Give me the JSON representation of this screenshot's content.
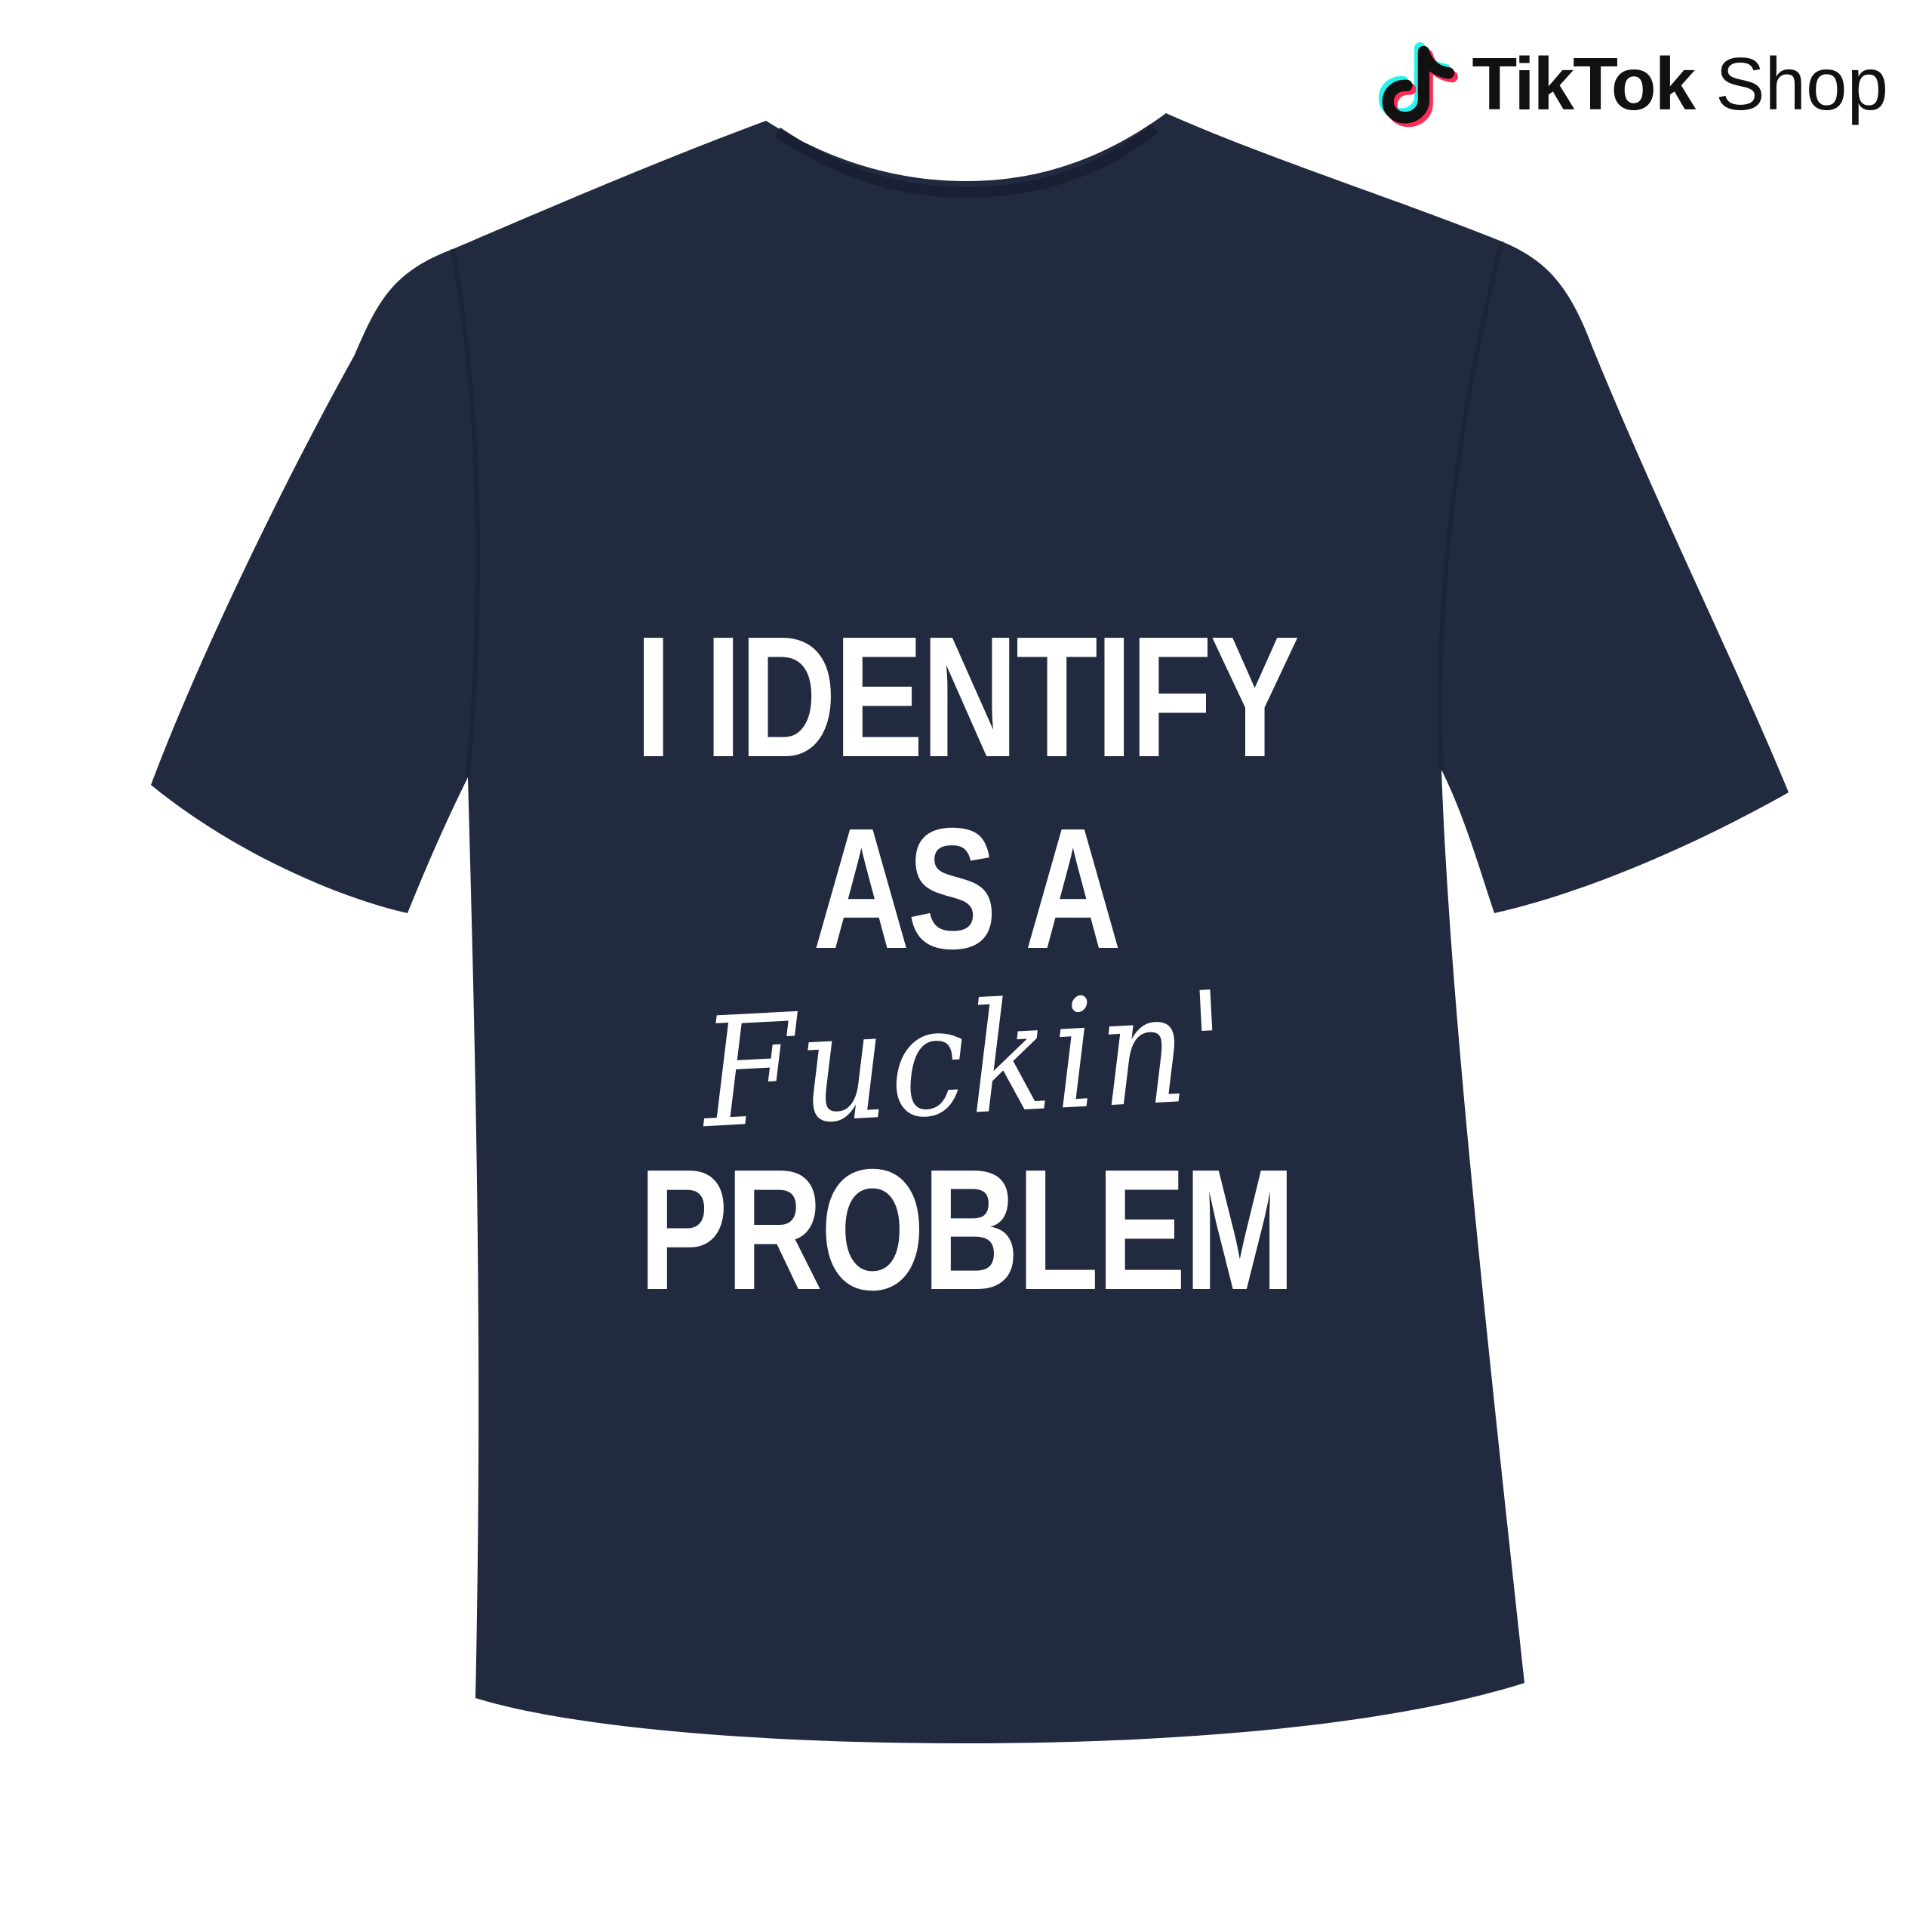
{
  "brand": {
    "name": "TikTok",
    "sub": "Shop"
  },
  "product": {
    "shirt_color": "#222a40",
    "print_color": "#ffffff",
    "print_lines": [
      "I IDENTIFY",
      "AS A",
      "Fuckin'",
      "PROBLEM"
    ]
  },
  "colors": {
    "background": "#ffffff",
    "logo_cyan": "#25f4ee",
    "logo_pink": "#fe2c55",
    "logo_black": "#111111"
  }
}
